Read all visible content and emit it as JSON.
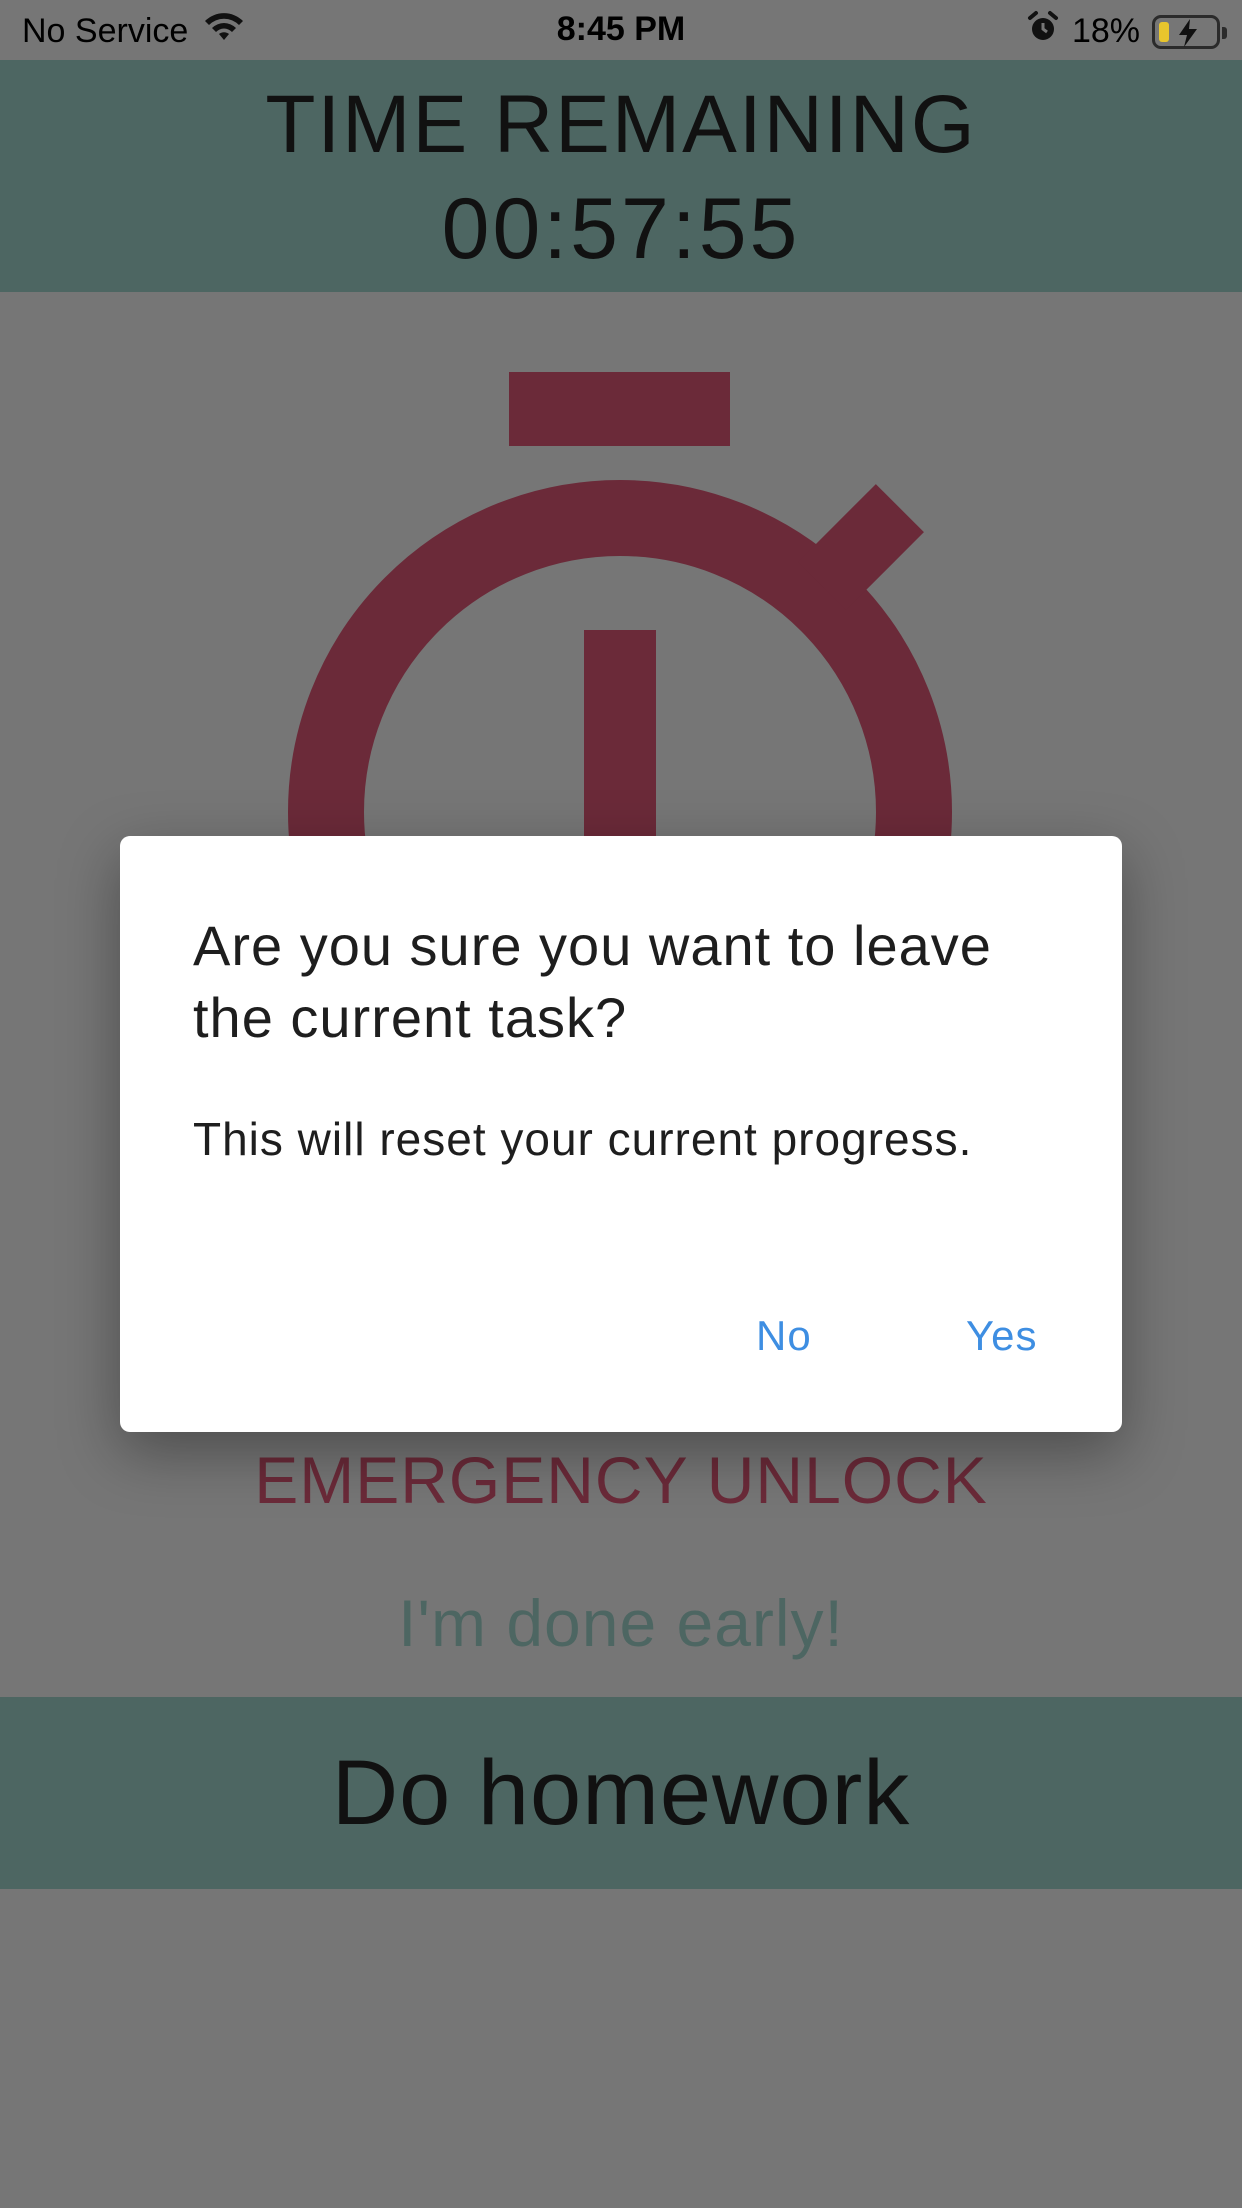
{
  "status_bar": {
    "carrier": "No Service",
    "time": "8:45 PM",
    "battery_percent": "18%",
    "battery_level": 0.18,
    "icons": [
      "wifi-icon",
      "alarm-icon",
      "battery-charging-icon"
    ]
  },
  "timer": {
    "title": "TIME REMAINING",
    "value": "00:57:55"
  },
  "stopwatch": {
    "icon": "stopwatch-icon",
    "color": "#6b2a39"
  },
  "actions": {
    "emergency_label": "EMERGENCY UNLOCK",
    "done_early_label": "I'm done early!"
  },
  "task": {
    "name": "Do homework"
  },
  "dialog": {
    "title": "Are you sure you want to leave the current task?",
    "message": "This will reset your current progress.",
    "no_label": "No",
    "yes_label": "Yes"
  },
  "colors": {
    "band": "#4d6662",
    "overlay_bg": "#767676",
    "accent_red": "#6b2a39",
    "link_blue": "#3e8ee2"
  }
}
